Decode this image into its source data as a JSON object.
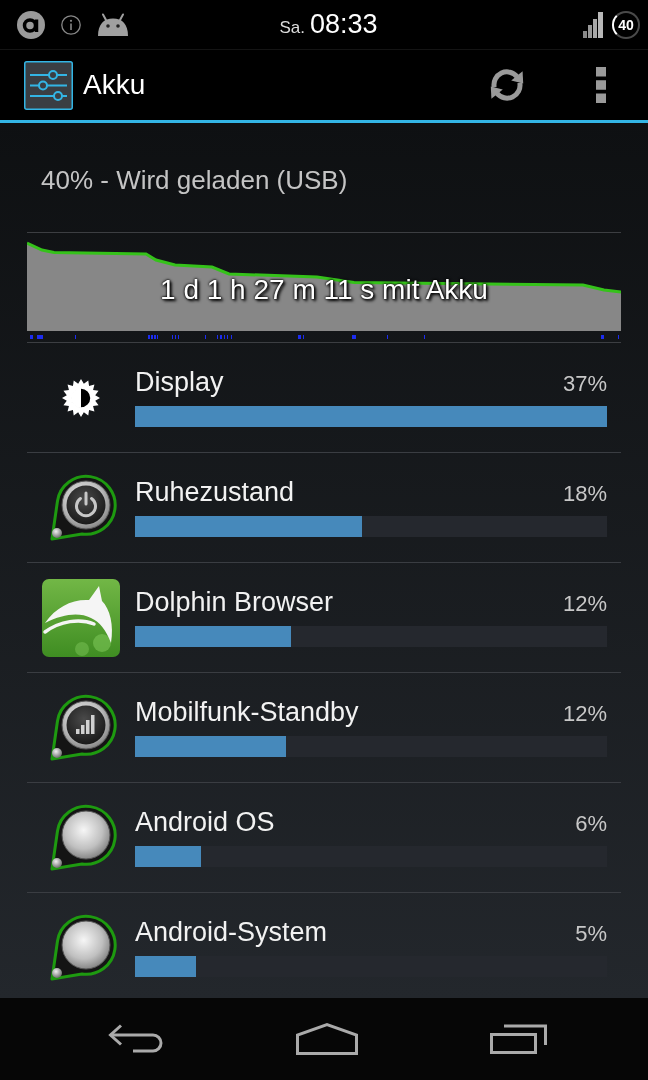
{
  "status_bar": {
    "day": "Sa.",
    "time": "08:33",
    "battery": "40"
  },
  "action_bar": {
    "title": "Akku"
  },
  "summary": "40% - Wird geladen (USB)",
  "history": {
    "duration": "1 d 1 h 27 m 11 s mit Akku"
  },
  "items": [
    {
      "kind": "brightness",
      "name": "Display",
      "percent": "37%",
      "level": 1.0
    },
    {
      "kind": "power",
      "name": "Ruhezustand",
      "percent": "18%",
      "level": 0.48
    },
    {
      "kind": "dolphin",
      "name": "Dolphin Browser",
      "percent": "12%",
      "level": 0.33
    },
    {
      "kind": "signal",
      "name": "Mobilfunk-Standby",
      "percent": "12%",
      "level": 0.32
    },
    {
      "kind": "generic",
      "name": "Android OS",
      "percent": "6%",
      "level": 0.14
    },
    {
      "kind": "generic",
      "name": "Android-System",
      "percent": "5%",
      "level": 0.13
    }
  ]
}
